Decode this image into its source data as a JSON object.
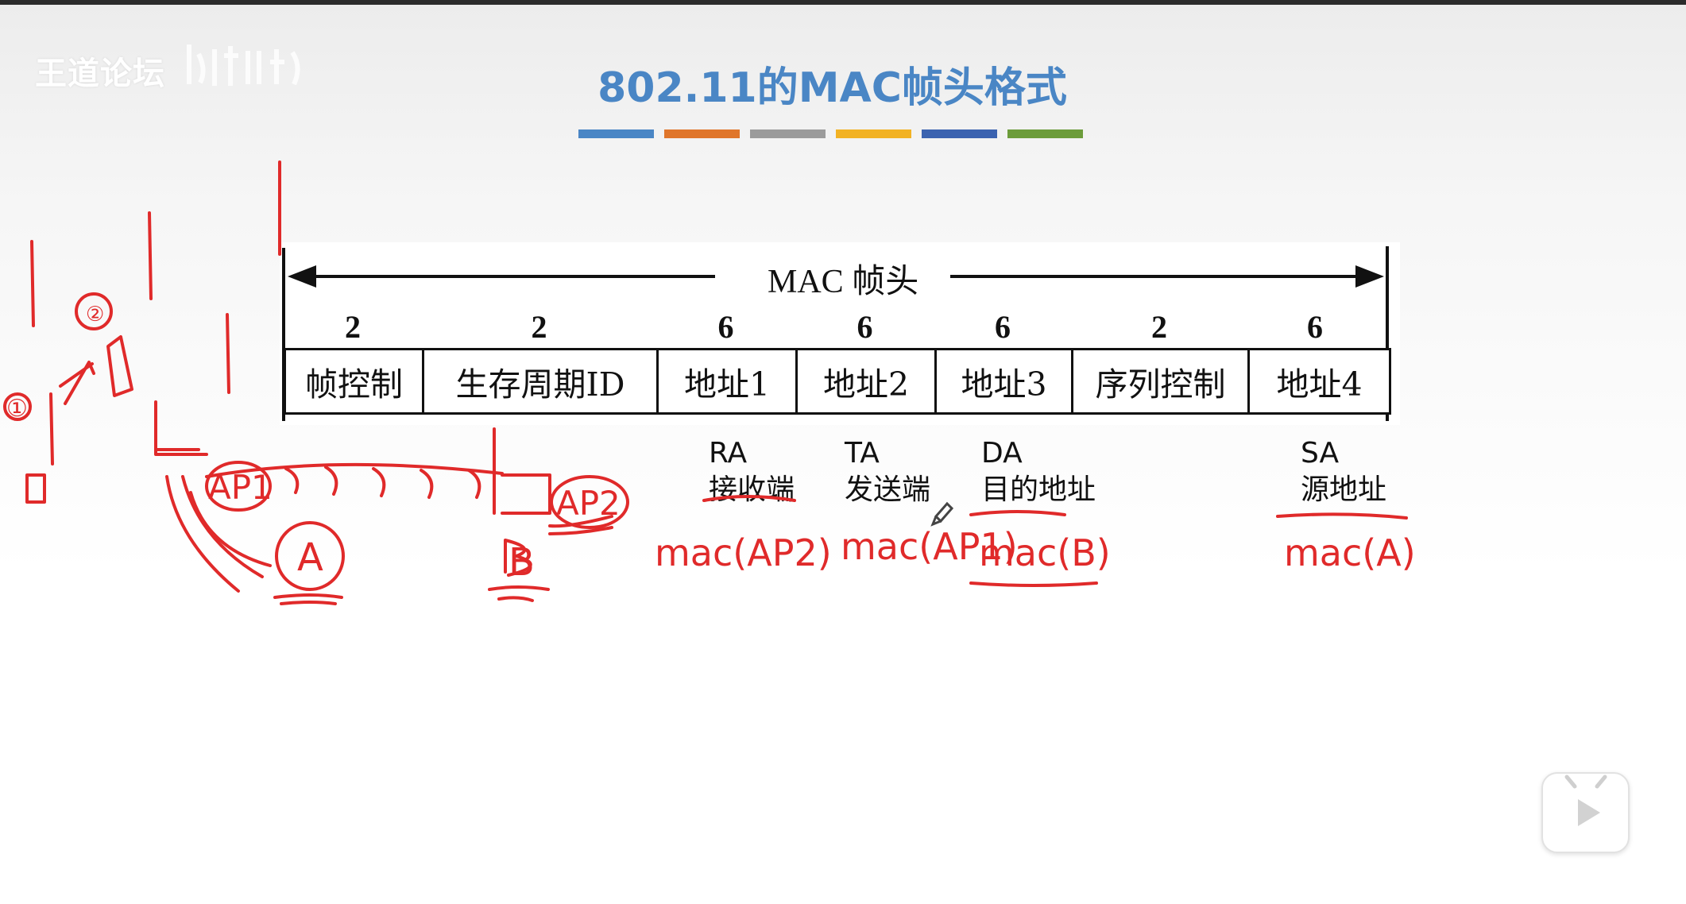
{
  "watermark": "王道论坛",
  "title": "802.11的MAC帧头格式",
  "color_bars": [
    "#4a86c5",
    "#e0762b",
    "#9b9b9b",
    "#f2b224",
    "#3b63b0",
    "#6c9c3a"
  ],
  "header_caption": "MAC 帧头",
  "fields": [
    {
      "size": "2",
      "label": "帧控制"
    },
    {
      "size": "2",
      "label": "生存周期ID"
    },
    {
      "size": "6",
      "label": "地址1"
    },
    {
      "size": "6",
      "label": "地址2"
    },
    {
      "size": "6",
      "label": "地址3"
    },
    {
      "size": "2",
      "label": "序列控制"
    },
    {
      "size": "6",
      "label": "地址4"
    }
  ],
  "annotations": [
    {
      "abbr": "RA",
      "desc": "接收端"
    },
    {
      "abbr": "TA",
      "desc": "发送端"
    },
    {
      "abbr": "DA",
      "desc": "目的地址"
    },
    {
      "abbr": "SA",
      "desc": "源地址"
    }
  ],
  "handwriting": {
    "circle_1": "①",
    "circle_2": "②",
    "ap1": "AP1",
    "ap2": "AP2",
    "node_a": "A",
    "node_b": "B",
    "addr1": "mac(AP2)",
    "addr2": "mac(AP1)",
    "addr3": "mac(B)",
    "addr4": "mac(A)"
  },
  "icons": {
    "play": "play-icon"
  }
}
